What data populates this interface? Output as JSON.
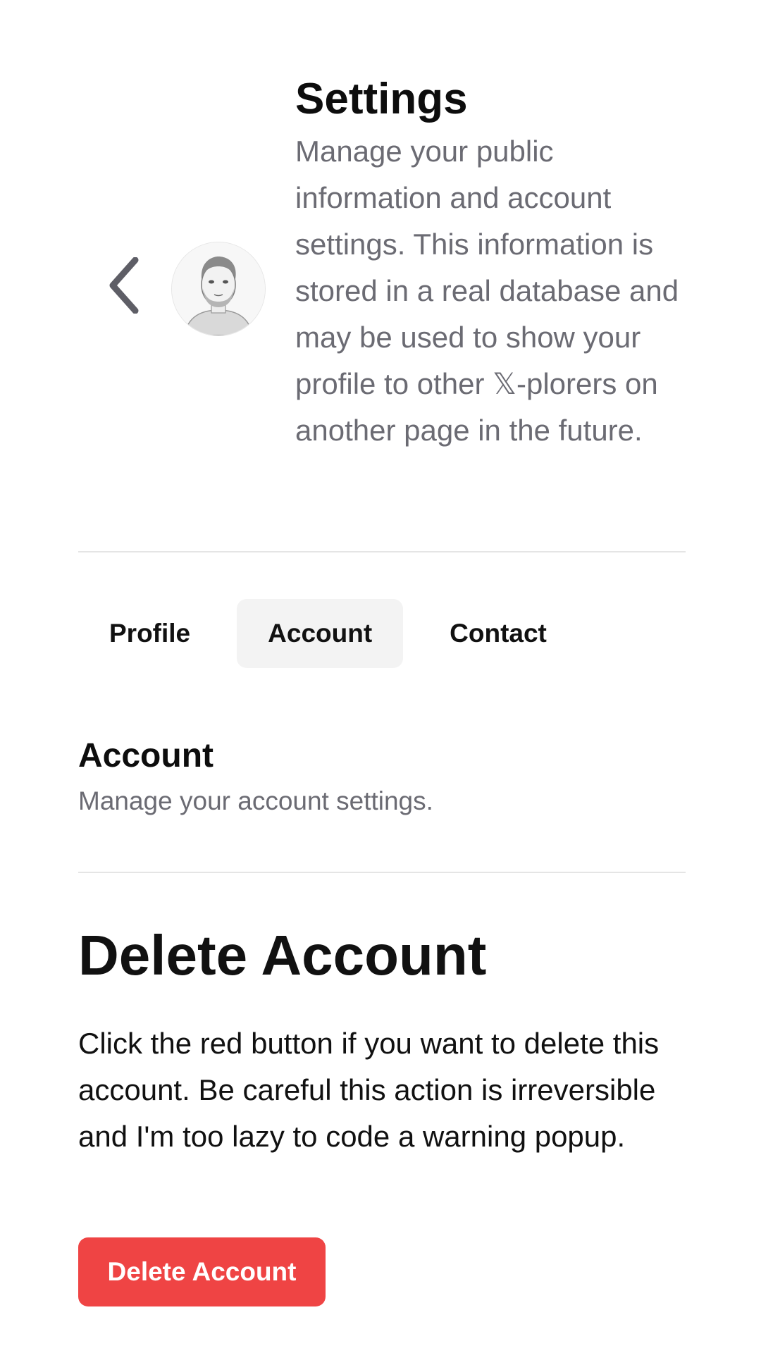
{
  "header": {
    "title": "Settings",
    "description": "Manage your public information and account settings. This information is stored in a real database and may be used to show your profile to other 𝕏-plorers on another page in the future.",
    "back_icon": "chevron-left-icon",
    "avatar_icon": "user-avatar-sketch"
  },
  "tabs": [
    {
      "label": "Profile",
      "active": false
    },
    {
      "label": "Account",
      "active": true
    },
    {
      "label": "Contact",
      "active": false
    }
  ],
  "section": {
    "title": "Account",
    "description": "Manage your account settings."
  },
  "danger": {
    "title": "Delete Account",
    "text": "Click the red button if you want to delete this account. Be careful this action is irreversible and I'm too lazy to code a warning popup.",
    "button_label": "Delete Account",
    "button_color": "#ef4444"
  },
  "colors": {
    "muted_text": "#6b6b73",
    "active_tab_bg": "#f3f3f3",
    "divider": "#e5e5e5"
  }
}
